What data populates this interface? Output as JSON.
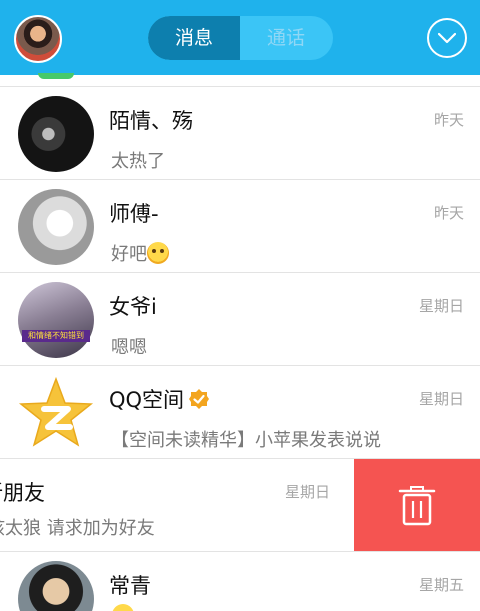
{
  "header": {
    "tabs": [
      {
        "label": "消息",
        "active": true
      },
      {
        "label": "通话",
        "active": false
      }
    ],
    "dropdown_icon": "chevron-down-circle-icon",
    "background_color": "#1fb2ec"
  },
  "conversations": [
    {
      "name": "陌情、殇",
      "preview": "太热了",
      "time": "昨天"
    },
    {
      "name": "师傅-",
      "preview": "好吧",
      "time": "昨天",
      "preview_emoji": "emoji-icon"
    },
    {
      "name": "女爷i",
      "preview": "嗯嗯",
      "time": "星期日",
      "avatar_text": "和情绪不知错到"
    },
    {
      "name": "QQ空间",
      "preview": "【空间未读精华】小苹果发表说说",
      "time": "星期日",
      "verified": true
    }
  ],
  "swiped_row": {
    "name": "新朋友",
    "preview": "孩太狼 请求加为好友",
    "time": "星期日",
    "delete_icon": "trash-icon",
    "delete_color": "#f55451"
  },
  "bottom_row": {
    "name": "常青",
    "time": "星期五"
  }
}
